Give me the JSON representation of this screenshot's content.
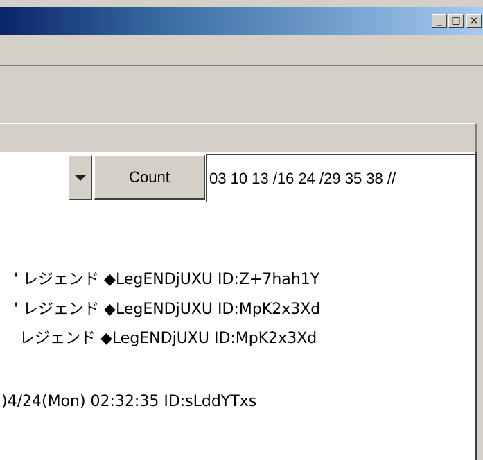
{
  "titlebar": {
    "buttons": {
      "minimize": "_",
      "maximize": "□",
      "close": "×"
    }
  },
  "toolbar": {
    "count_label": "Count",
    "count_input_value": "03 10 13 /16 24 /29 35 38 //"
  },
  "content": {
    "lines": [
      "' レジェンド ◆LegENDjUXU ID:Z+7hah1Y",
      "' レジェンド ◆LegENDjUXU ID:MpK2x3Xd",
      "レジェンド ◆LegENDjUXU ID:MpK2x3Xd",
      ")4/24(Mon) 02:32:35 ID:sLddYTxs"
    ]
  },
  "colors": {
    "titlebar_start": "#0a246a",
    "titlebar_end": "#a6caf0",
    "face": "#d4d0c8"
  }
}
